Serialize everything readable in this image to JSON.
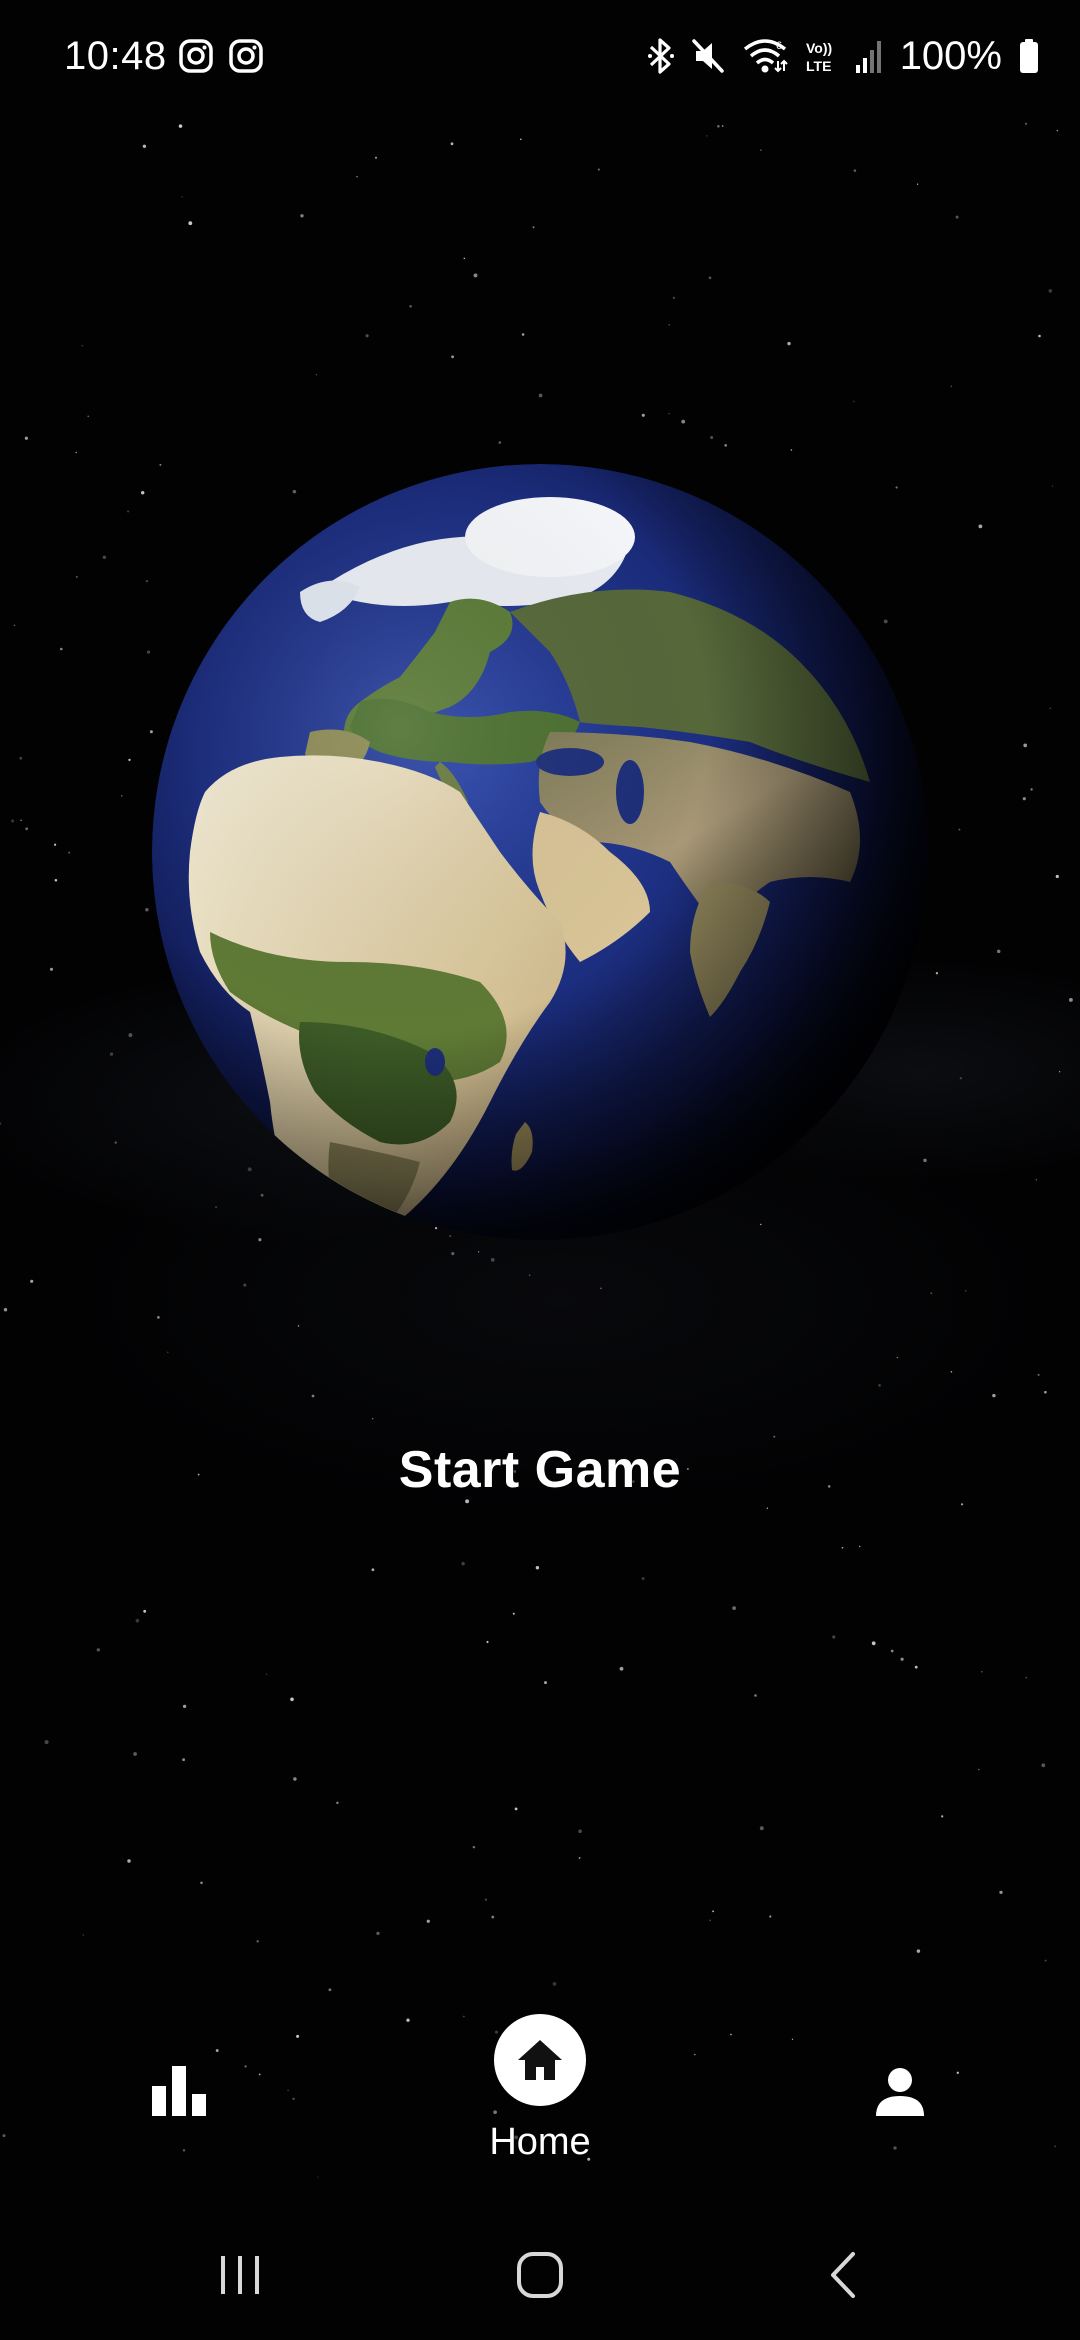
{
  "status_bar": {
    "time": "10:48",
    "battery": "100%",
    "left_icons": [
      "instagram-icon",
      "instagram-icon"
    ],
    "right_icons": [
      "bluetooth-icon",
      "mute-icon",
      "wifi-icon",
      "volte-icon",
      "signal-icon",
      "battery-icon"
    ],
    "volte_text": "Vo))\nLTE"
  },
  "main": {
    "start_game_label": "Start Game",
    "background_color": "#020203"
  },
  "bottom_nav": {
    "items": [
      {
        "icon": "bar-chart-icon",
        "label": "",
        "active": false
      },
      {
        "icon": "home-icon",
        "label": "Home",
        "active": true
      },
      {
        "icon": "profile-icon",
        "label": "",
        "active": false
      }
    ]
  },
  "system_nav": {
    "buttons": [
      "recent-apps-icon",
      "home-outline-icon",
      "back-icon"
    ]
  }
}
